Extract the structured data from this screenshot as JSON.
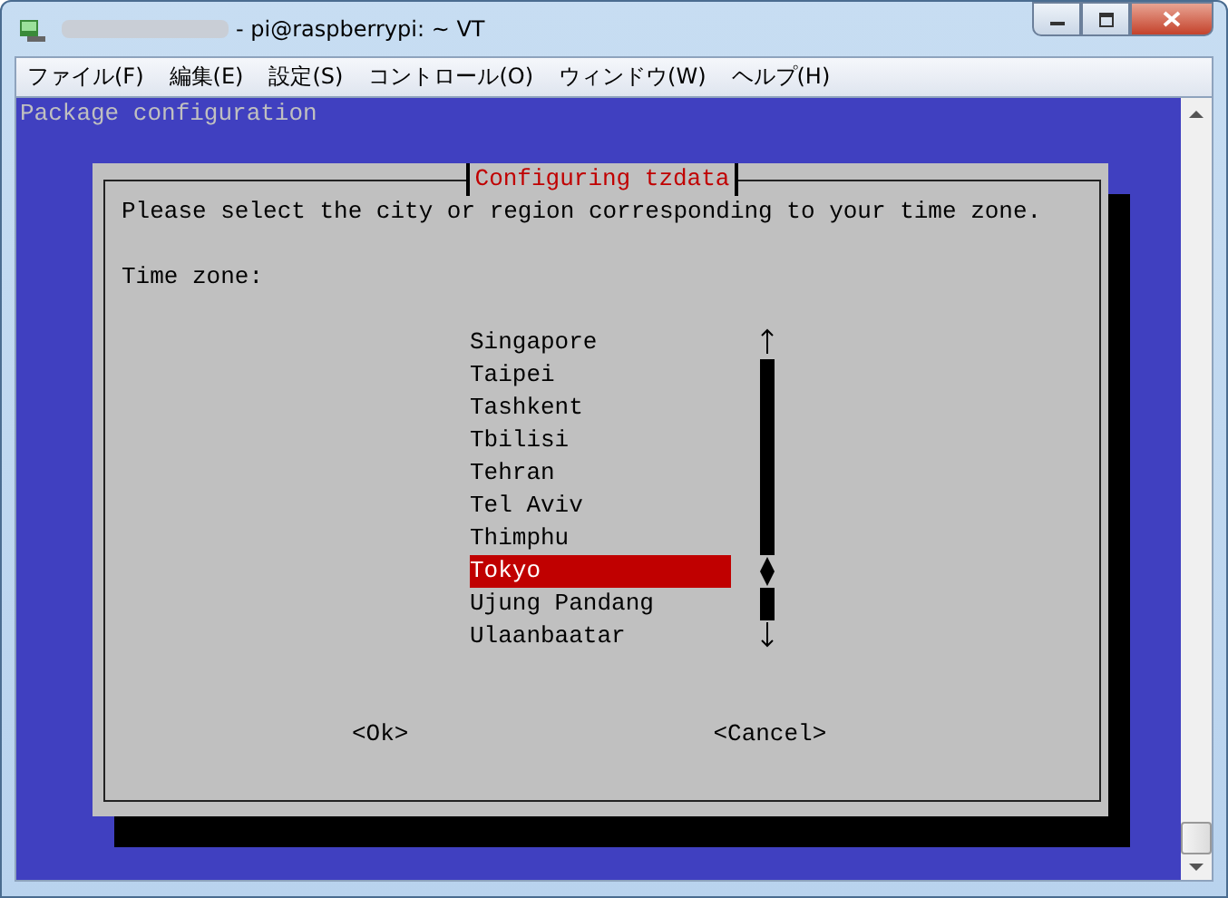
{
  "window": {
    "title": "- pi@raspberrypi: ~ VT"
  },
  "menu": [
    "ファイル(F)",
    "編集(E)",
    "設定(S)",
    "コントロール(O)",
    "ウィンドウ(W)",
    "ヘルプ(H)"
  ],
  "terminal": {
    "header": "Package configuration",
    "dialog": {
      "title": "Configuring tzdata",
      "prompt": "Please select the city or region corresponding to your time zone.",
      "label": "Time zone:",
      "items": [
        {
          "label": "Singapore",
          "selected": false
        },
        {
          "label": "Taipei",
          "selected": false
        },
        {
          "label": "Tashkent",
          "selected": false
        },
        {
          "label": "Tbilisi",
          "selected": false
        },
        {
          "label": "Tehran",
          "selected": false
        },
        {
          "label": "Tel Aviv",
          "selected": false
        },
        {
          "label": "Thimphu",
          "selected": false
        },
        {
          "label": "Tokyo",
          "selected": true
        },
        {
          "label": "Ujung Pandang",
          "selected": false
        },
        {
          "label": "Ulaanbaatar",
          "selected": false
        }
      ],
      "buttons": [
        "<Ok>",
        "<Cancel>"
      ]
    }
  }
}
